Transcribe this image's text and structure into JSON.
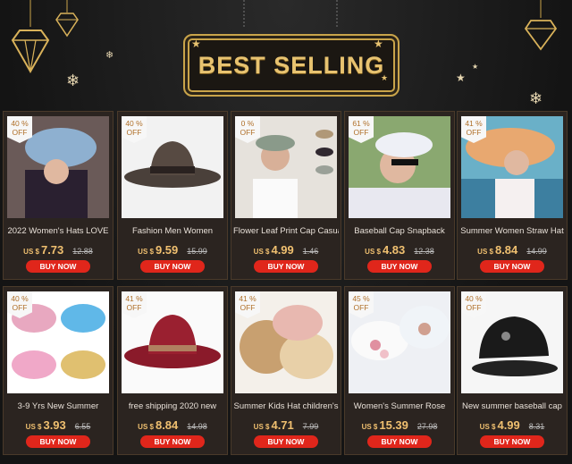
{
  "header": {
    "title": "BEST SELLING"
  },
  "products": [
    {
      "title": "2022 Women's Hats LOVE",
      "badge_pct": "40 %",
      "badge_off": "OFF",
      "currency": "US $",
      "price": "7.73",
      "old_price": "12.88",
      "button": "BUY NOW",
      "icon": "denim-cap-image"
    },
    {
      "title": "Fashion Men Women",
      "badge_pct": "40 %",
      "badge_off": "OFF",
      "currency": "US $",
      "price": "9.59",
      "old_price": "15.99",
      "button": "BUY NOW",
      "icon": "cowboy-hat-image"
    },
    {
      "title": "Flower Leaf Print Cap Casual",
      "badge_pct": "0 %",
      "badge_off": "OFF",
      "currency": "US $",
      "price": "4.99",
      "old_price": "1.46",
      "button": "BUY NOW",
      "icon": "visor-cap-image"
    },
    {
      "title": "Baseball Cap Snapback",
      "badge_pct": "61 %",
      "badge_off": "OFF",
      "currency": "US $",
      "price": "4.83",
      "old_price": "12.38",
      "button": "BUY NOW",
      "icon": "mesh-cap-image"
    },
    {
      "title": "Summer Women Straw Hat",
      "badge_pct": "41 %",
      "badge_off": "OFF",
      "currency": "US $",
      "price": "8.84",
      "old_price": "14.99",
      "button": "BUY NOW",
      "icon": "straw-hat-image"
    },
    {
      "title": "3-9 Yrs New Summer",
      "badge_pct": "40 %",
      "badge_off": "OFF",
      "currency": "US $",
      "price": "3.93",
      "old_price": "6.55",
      "button": "BUY NOW",
      "icon": "sequin-kids-caps-image"
    },
    {
      "title": "free shipping 2020 new",
      "badge_pct": "41 %",
      "badge_off": "OFF",
      "currency": "US $",
      "price": "8.84",
      "old_price": "14.98",
      "button": "BUY NOW",
      "icon": "fedora-hat-image"
    },
    {
      "title": "Summer Kids Hat children's",
      "badge_pct": "41 %",
      "badge_off": "OFF",
      "currency": "US $",
      "price": "4.71",
      "old_price": "7.99",
      "button": "BUY NOW",
      "icon": "bunny-straw-hat-image"
    },
    {
      "title": "Women's Summer Rose",
      "badge_pct": "45 %",
      "badge_off": "OFF",
      "currency": "US $",
      "price": "15.39",
      "old_price": "27.98",
      "button": "BUY NOW",
      "icon": "rose-caps-image"
    },
    {
      "title": "New summer baseball cap",
      "badge_pct": "40 %",
      "badge_off": "OFF",
      "currency": "US $",
      "price": "4.99",
      "old_price": "8.31",
      "button": "BUY NOW",
      "icon": "black-mesh-cap-image"
    }
  ]
}
